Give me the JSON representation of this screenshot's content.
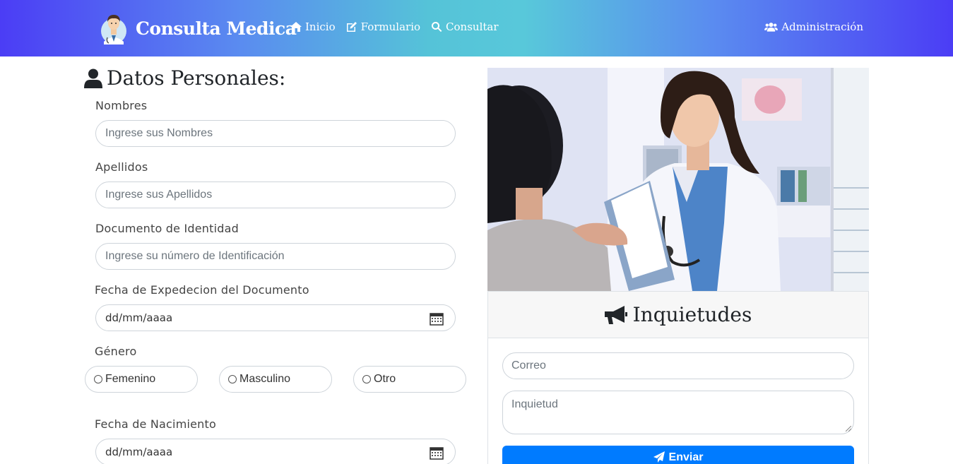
{
  "navbar": {
    "brand": "Consulta Medica",
    "links": [
      {
        "label": "Inicio",
        "icon": "home-icon"
      },
      {
        "label": "Formulario",
        "icon": "edit-icon"
      },
      {
        "label": "Consultar",
        "icon": "search-icon"
      }
    ],
    "admin": {
      "label": "Administración",
      "icon": "users-icon"
    }
  },
  "form": {
    "title": "Datos Personales:",
    "fields": {
      "nombres": {
        "label": "Nombres",
        "placeholder": "Ingrese sus Nombres"
      },
      "apellidos": {
        "label": "Apellidos",
        "placeholder": "Ingrese sus Apellidos"
      },
      "documento": {
        "label": "Documento de Identidad",
        "placeholder": "Ingrese su número de Identificación"
      },
      "expedicion": {
        "label": "Fecha de Expedecion del Documento",
        "value": "dd/mm/aaaa"
      },
      "genero": {
        "label": "Género",
        "options": [
          "Femenino",
          "Masculino",
          "Otro"
        ]
      },
      "nacimiento": {
        "label": "Fecha de Nacimiento",
        "value": "dd/mm/aaaa"
      }
    }
  },
  "inquietudes": {
    "title": "Inquietudes",
    "correo_placeholder": "Correo",
    "inquietud_placeholder": "Inquietud",
    "submit": "Enviar"
  },
  "colors": {
    "nav_left": "#4b3df5",
    "nav_mid": "#55c3d8",
    "primary": "#007bff"
  }
}
